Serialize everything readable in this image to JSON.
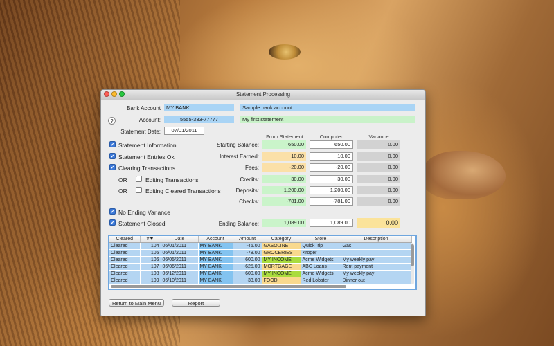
{
  "window": {
    "title": "Statement Processing"
  },
  "header": {
    "bank_account_label": "Bank Account",
    "bank_account_value": "MY BANK",
    "bank_account_desc": "Sample bank account",
    "account_label": "Account:",
    "account_value": "5555-333-77777",
    "account_desc": "My first statement",
    "statement_date_label": "Statement Date:",
    "statement_date_value": "07/01/2011",
    "help": "?"
  },
  "checks": {
    "statement_information": "Statement Information",
    "statement_entries_ok": "Statement Entries Ok",
    "clearing_transactions": "Clearing Transactions",
    "or1": "OR",
    "editing_transactions": "Editing Transactions",
    "or2": "OR",
    "editing_cleared_transactions": "Editing Cleared Transactions",
    "no_ending_variance": "No Ending Variance",
    "statement_closed": "Statement Closed"
  },
  "balances": {
    "col_from_statement": "From Statement",
    "col_computed": "Computed",
    "col_variance": "Variance",
    "rows": [
      {
        "label": "Starting Balance:",
        "from": "650.00",
        "computed": "650.00",
        "variance": "0.00"
      },
      {
        "label": "Interest Earned:",
        "from": "10.00",
        "computed": "10.00",
        "variance": "0.00"
      },
      {
        "label": "Fees:",
        "from": "-20.00",
        "computed": "-20.00",
        "variance": "0.00"
      },
      {
        "label": "Credits:",
        "from": "30.00",
        "computed": "30.00",
        "variance": "0.00"
      },
      {
        "label": "Deposits:",
        "from": "1,200.00",
        "computed": "1,200.00",
        "variance": "0.00"
      },
      {
        "label": "Checks:",
        "from": "-781.00",
        "computed": "-781.00",
        "variance": "0.00"
      }
    ],
    "ending": {
      "label": "Ending Balance:",
      "from": "1,089.00",
      "computed": "1,089.00",
      "variance": "0.00"
    }
  },
  "table": {
    "headers": [
      "Cleared",
      "#▼",
      "Date",
      "Account",
      "Amount",
      "Category",
      "Store",
      "Description"
    ],
    "rows": [
      [
        "Cleared",
        "104",
        "06/01/2011",
        "MY BANK",
        "-45.00",
        "GASOLINE",
        "QuickTrip",
        "Gas"
      ],
      [
        "Cleared",
        "105",
        "06/01/2011",
        "MY BANK",
        "-78.00",
        "GROCERIES",
        "Kroger",
        ""
      ],
      [
        "Cleared",
        "106",
        "06/05/2011",
        "MY BANK",
        "600.00",
        "MY INCOME",
        "Acme Widgets",
        "My weekly pay"
      ],
      [
        "Cleared",
        "107",
        "06/06/2011",
        "MY BANK",
        "-625.00",
        "MORTGAGE",
        "ABC Loans",
        "Rent payment"
      ],
      [
        "Cleared",
        "108",
        "06/12/2011",
        "MY BANK",
        "600.00",
        "MY INCOME",
        "Acme Widgets",
        "My weekly pay"
      ],
      [
        "Cleared",
        "109",
        "06/10/2011",
        "MY BANK",
        "-33.00",
        "FOOD",
        "Red Lobster",
        "Dinner out"
      ]
    ]
  },
  "buttons": {
    "return": "Return to Main Menu",
    "report": "Report"
  }
}
